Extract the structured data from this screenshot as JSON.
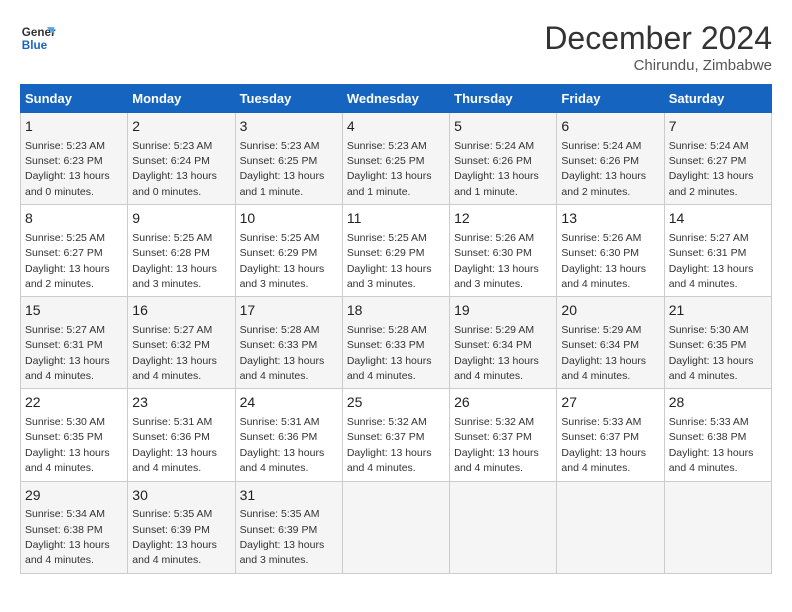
{
  "header": {
    "logo_general": "General",
    "logo_blue": "Blue",
    "month": "December 2024",
    "location": "Chirundu, Zimbabwe"
  },
  "days_of_week": [
    "Sunday",
    "Monday",
    "Tuesday",
    "Wednesday",
    "Thursday",
    "Friday",
    "Saturday"
  ],
  "weeks": [
    [
      {
        "day": "1",
        "sunrise": "5:23 AM",
        "sunset": "6:23 PM",
        "daylight": "13 hours and 0 minutes."
      },
      {
        "day": "2",
        "sunrise": "5:23 AM",
        "sunset": "6:24 PM",
        "daylight": "13 hours and 0 minutes."
      },
      {
        "day": "3",
        "sunrise": "5:23 AM",
        "sunset": "6:25 PM",
        "daylight": "13 hours and 1 minute."
      },
      {
        "day": "4",
        "sunrise": "5:23 AM",
        "sunset": "6:25 PM",
        "daylight": "13 hours and 1 minute."
      },
      {
        "day": "5",
        "sunrise": "5:24 AM",
        "sunset": "6:26 PM",
        "daylight": "13 hours and 1 minute."
      },
      {
        "day": "6",
        "sunrise": "5:24 AM",
        "sunset": "6:26 PM",
        "daylight": "13 hours and 2 minutes."
      },
      {
        "day": "7",
        "sunrise": "5:24 AM",
        "sunset": "6:27 PM",
        "daylight": "13 hours and 2 minutes."
      }
    ],
    [
      {
        "day": "8",
        "sunrise": "5:25 AM",
        "sunset": "6:27 PM",
        "daylight": "13 hours and 2 minutes."
      },
      {
        "day": "9",
        "sunrise": "5:25 AM",
        "sunset": "6:28 PM",
        "daylight": "13 hours and 3 minutes."
      },
      {
        "day": "10",
        "sunrise": "5:25 AM",
        "sunset": "6:29 PM",
        "daylight": "13 hours and 3 minutes."
      },
      {
        "day": "11",
        "sunrise": "5:25 AM",
        "sunset": "6:29 PM",
        "daylight": "13 hours and 3 minutes."
      },
      {
        "day": "12",
        "sunrise": "5:26 AM",
        "sunset": "6:30 PM",
        "daylight": "13 hours and 3 minutes."
      },
      {
        "day": "13",
        "sunrise": "5:26 AM",
        "sunset": "6:30 PM",
        "daylight": "13 hours and 4 minutes."
      },
      {
        "day": "14",
        "sunrise": "5:27 AM",
        "sunset": "6:31 PM",
        "daylight": "13 hours and 4 minutes."
      }
    ],
    [
      {
        "day": "15",
        "sunrise": "5:27 AM",
        "sunset": "6:31 PM",
        "daylight": "13 hours and 4 minutes."
      },
      {
        "day": "16",
        "sunrise": "5:27 AM",
        "sunset": "6:32 PM",
        "daylight": "13 hours and 4 minutes."
      },
      {
        "day": "17",
        "sunrise": "5:28 AM",
        "sunset": "6:33 PM",
        "daylight": "13 hours and 4 minutes."
      },
      {
        "day": "18",
        "sunrise": "5:28 AM",
        "sunset": "6:33 PM",
        "daylight": "13 hours and 4 minutes."
      },
      {
        "day": "19",
        "sunrise": "5:29 AM",
        "sunset": "6:34 PM",
        "daylight": "13 hours and 4 minutes."
      },
      {
        "day": "20",
        "sunrise": "5:29 AM",
        "sunset": "6:34 PM",
        "daylight": "13 hours and 4 minutes."
      },
      {
        "day": "21",
        "sunrise": "5:30 AM",
        "sunset": "6:35 PM",
        "daylight": "13 hours and 4 minutes."
      }
    ],
    [
      {
        "day": "22",
        "sunrise": "5:30 AM",
        "sunset": "6:35 PM",
        "daylight": "13 hours and 4 minutes."
      },
      {
        "day": "23",
        "sunrise": "5:31 AM",
        "sunset": "6:36 PM",
        "daylight": "13 hours and 4 minutes."
      },
      {
        "day": "24",
        "sunrise": "5:31 AM",
        "sunset": "6:36 PM",
        "daylight": "13 hours and 4 minutes."
      },
      {
        "day": "25",
        "sunrise": "5:32 AM",
        "sunset": "6:37 PM",
        "daylight": "13 hours and 4 minutes."
      },
      {
        "day": "26",
        "sunrise": "5:32 AM",
        "sunset": "6:37 PM",
        "daylight": "13 hours and 4 minutes."
      },
      {
        "day": "27",
        "sunrise": "5:33 AM",
        "sunset": "6:37 PM",
        "daylight": "13 hours and 4 minutes."
      },
      {
        "day": "28",
        "sunrise": "5:33 AM",
        "sunset": "6:38 PM",
        "daylight": "13 hours and 4 minutes."
      }
    ],
    [
      {
        "day": "29",
        "sunrise": "5:34 AM",
        "sunset": "6:38 PM",
        "daylight": "13 hours and 4 minutes."
      },
      {
        "day": "30",
        "sunrise": "5:35 AM",
        "sunset": "6:39 PM",
        "daylight": "13 hours and 4 minutes."
      },
      {
        "day": "31",
        "sunrise": "5:35 AM",
        "sunset": "6:39 PM",
        "daylight": "13 hours and 3 minutes."
      },
      null,
      null,
      null,
      null
    ]
  ]
}
